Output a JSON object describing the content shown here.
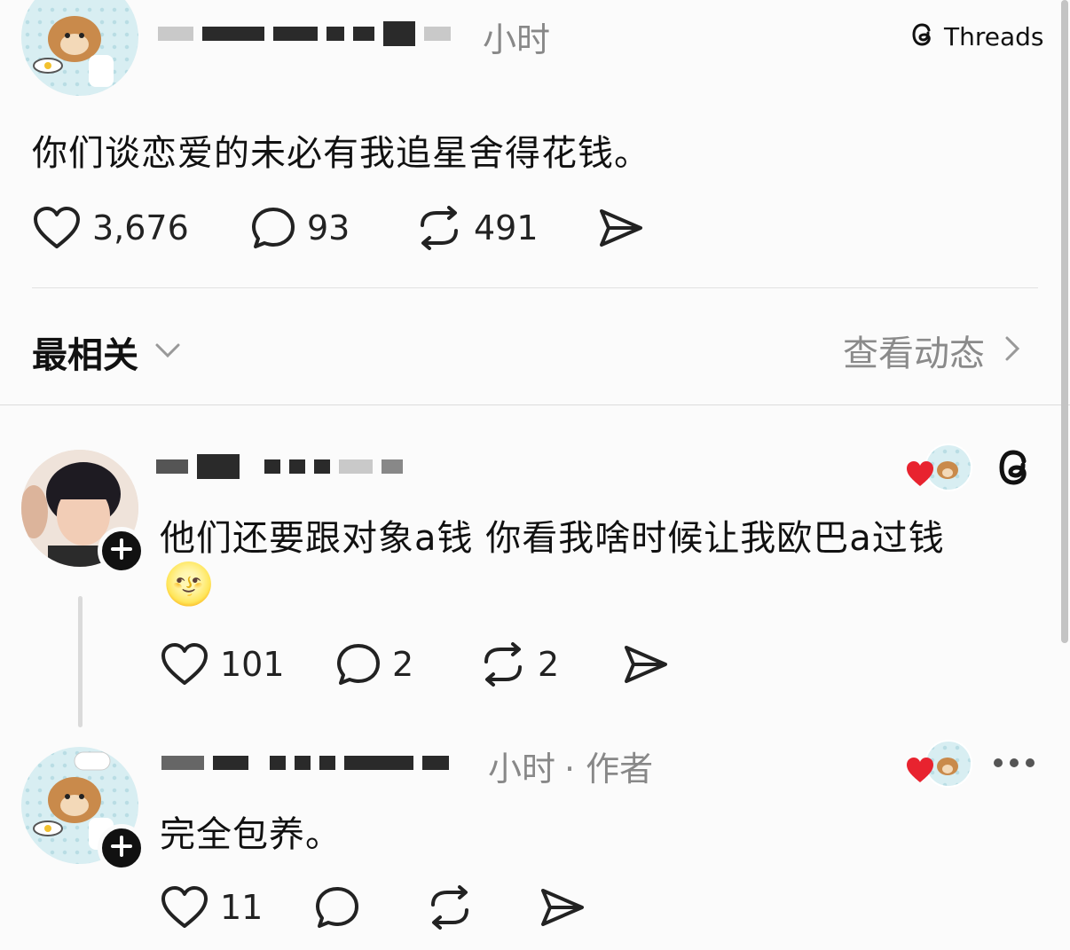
{
  "header": {
    "brand_label": "Threads"
  },
  "post": {
    "time_text": "小时",
    "body": "你们谈恋爱的未必有我追星舍得花钱。",
    "likes": "3,676",
    "comments": "93",
    "reposts": "491"
  },
  "sort_bar": {
    "label": "最相关",
    "activity_link": "查看动态"
  },
  "replies": [
    {
      "body": "他们还要跟对象a钱 你看我啥时候让我欧巴a过钱",
      "emoji": "🌝",
      "likes": "101",
      "comments": "2",
      "reposts": "2"
    },
    {
      "time_text": "小时",
      "author_tag": "· 作者",
      "body": "完全包养。",
      "likes": "11"
    }
  ],
  "icons": {
    "like": "heart-icon",
    "comment": "comment-bubble-icon",
    "repost": "repost-icon",
    "share": "send-icon",
    "threads": "threads-logo-icon",
    "more": "more-icon",
    "chevron_down": "chevron-down-icon",
    "chevron_right": "chevron-right-icon",
    "follow": "plus-icon"
  },
  "colors": {
    "like_heart": "#e8232f",
    "meta_gray": "#8a8a8a",
    "text": "#111111"
  }
}
